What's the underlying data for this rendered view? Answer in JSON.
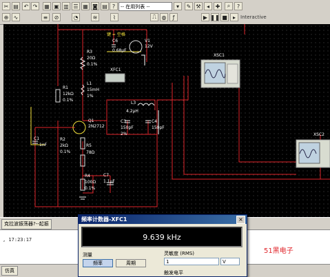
{
  "toolbar": {
    "combo_value": "-- 在用列表 --",
    "interactive_label": "Interactive"
  },
  "schematic": {
    "key_label": "键 = 空格",
    "components": {
      "c6": {
        "name": "C6",
        "value": "0.68μF"
      },
      "v1": {
        "name": "V1",
        "value": "12V"
      },
      "r3": {
        "name": "R3",
        "value": "20Ω",
        "tol": "0.1%"
      },
      "xfc1": {
        "name": "XFC1"
      },
      "l1": {
        "name": "L1",
        "value": "15mH",
        "tol": "1%"
      },
      "r1": {
        "name": "R1",
        "value": "12kΩ",
        "tol": "0.1%"
      },
      "l3": {
        "name": "L3",
        "value": "4.2μH"
      },
      "q1": {
        "name": "Q1",
        "value": "2N2712"
      },
      "c3": {
        "name": "C3",
        "value": "150pF",
        "tol": "2%"
      },
      "c4": {
        "name": "C4",
        "value": "150pF"
      },
      "c1": {
        "name": "C1",
        "value": "1nF"
      },
      "r2": {
        "name": "R2",
        "value": "2kΩ",
        "tol": "0.1%"
      },
      "r5": {
        "name": "R5",
        "value": "78Ω"
      },
      "r4": {
        "name": "R4",
        "value": "100Ω",
        "tol": "0.1%"
      },
      "c7": {
        "name": "C7",
        "value": "1.1μF"
      },
      "xsc1": {
        "name": "XSC1"
      },
      "xsc2": {
        "name": "XSC2"
      }
    }
  },
  "status": {
    "tab_label": "克拉波振荡器?--起振"
  },
  "log": {
    "line": ", 17:23:17"
  },
  "watermark": "51黑电子",
  "bottom_tab": "仿真",
  "dialog": {
    "title": "频率计数器-XFC1",
    "reading": "9.639 kHz",
    "measure_label": "测量",
    "freq_button": "频率",
    "period_button": "周期",
    "sensitivity_label": "灵敏度 (RMS)",
    "sensitivity_value": "1",
    "sensitivity_unit": "V",
    "trigger_label": "触发电平"
  }
}
